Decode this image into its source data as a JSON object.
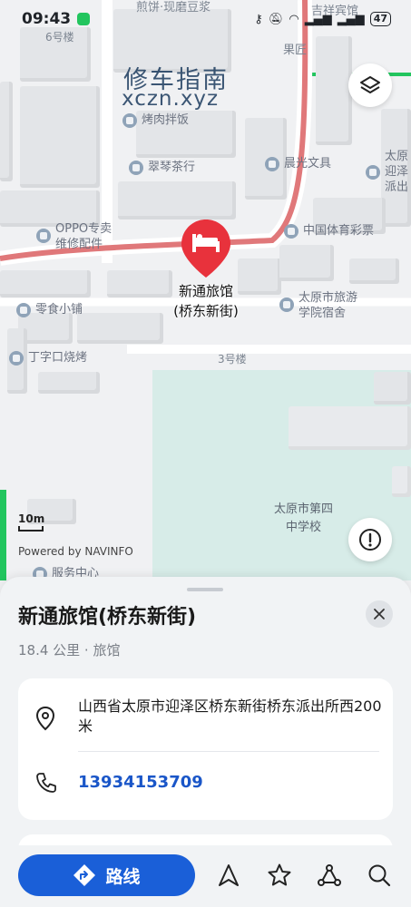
{
  "status_bar": {
    "time": "09:43",
    "battery": "47"
  },
  "watermark": {
    "cn": "修车指南",
    "en": "xczn.xyz"
  },
  "map": {
    "top_labels": [
      "煎饼·现磨豆浆",
      "6号楼",
      "吉祥宾馆",
      "果匠"
    ],
    "pois": {
      "barbecue_top": "烤肉拌饭",
      "cuiqin": "翠琴茶行",
      "chenguang": "晨光文具",
      "lottery": "中国体育彩票",
      "oppo": "OPPO专卖\n维修配件",
      "snacks": "零食小铺",
      "tourism_school": "太原市旅游\n学院宿舍",
      "dingzikou": "丁字口烧烤",
      "police_right": "太原\n迎泽\n派出",
      "service_center": "服务中心"
    },
    "building_3": "3号楼",
    "school": "太原市第四\n中学校",
    "pin_label": "新通旅馆\n(桥东新街)",
    "scale": "10m",
    "powered_by": "Powered by NAVINFO"
  },
  "sheet": {
    "title": "新通旅馆(桥东新街)",
    "subtitle": "18.4 公里 · 旅馆",
    "address": "山西省太原市迎泽区桥东新街桥东派出所西200米",
    "phone": "13934153709"
  },
  "actions": {
    "route_label": "路线"
  },
  "colors": {
    "accent": "#1a5fd8",
    "pin": "#e8323c",
    "road": "#e0787a",
    "phone": "#1a56c8"
  }
}
